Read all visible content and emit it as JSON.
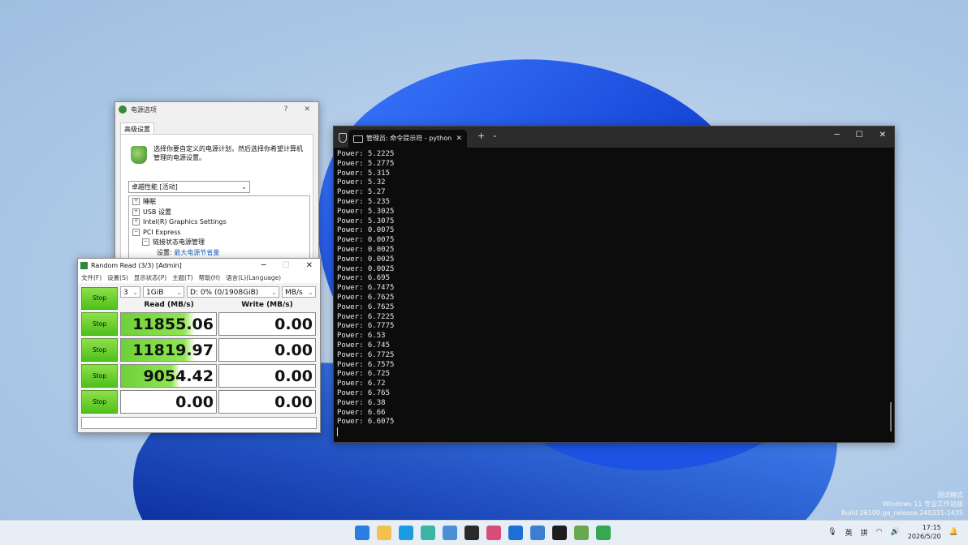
{
  "desktop": {
    "watermark": [
      "测试模式",
      "Windows 11 专业工作站版",
      "Build 26100.ge_release.240331-1435"
    ]
  },
  "power_window": {
    "title": "电源选项",
    "help": "?",
    "close": "✕",
    "tab": "高级设置",
    "description": "选择你要自定义的电源计划，然后选择你希望计算机管理的电源设置。",
    "plan": "卓越性能 [活动]",
    "tree": [
      {
        "sign": "+",
        "label": "睡眠",
        "indent": 0
      },
      {
        "sign": "+",
        "label": "USB 设置",
        "indent": 0
      },
      {
        "sign": "+",
        "label": "Intel(R) Graphics Settings",
        "indent": 0
      },
      {
        "sign": "−",
        "label": "PCI Express",
        "indent": 0
      },
      {
        "sign": "−",
        "label": "链接状态电源管理",
        "indent": 1
      }
    ],
    "setting_label": "设置:",
    "setting_value": "最大电源节省量"
  },
  "cdm_window": {
    "title": "Random Read (3/3) [Admin]",
    "menu": [
      "文件(F)",
      "设置(S)",
      "显示状态(P)",
      "主题(T)",
      "帮助(H)",
      "语言(L)(Language)"
    ],
    "stop_label": "Stop",
    "count": "3",
    "size": "1GiB",
    "drive": "D: 0% (0/1908GiB)",
    "unit": "MB/s",
    "read_header": "Read (MB/s)",
    "write_header": "Write (MB/s)",
    "rows": [
      {
        "read": "11855.06",
        "write": "0.00",
        "read_fill": 0.78
      },
      {
        "read": "11819.97",
        "write": "0.00",
        "read_fill": 0.78
      },
      {
        "read": "9054.42",
        "write": "0.00",
        "read_fill": 0.62
      },
      {
        "read": "0.00",
        "write": "0.00",
        "read_fill": 0
      }
    ]
  },
  "terminal": {
    "tab_title": "管理员: 命令提示符 - python",
    "tab_close": "✕",
    "new_tab": "+",
    "dropdown": "⌄",
    "min": "─",
    "max": "☐",
    "close": "✕",
    "lines": [
      "Power: 5.2225",
      "Power: 5.2775",
      "Power: 5.315",
      "Power: 5.32",
      "Power: 5.27",
      "Power: 5.235",
      "Power: 5.3025",
      "Power: 5.3075",
      "Power: 0.0075",
      "Power: 0.0075",
      "Power: 0.0025",
      "Power: 0.0025",
      "Power: 0.0025",
      "Power: 6.695",
      "Power: 6.7475",
      "Power: 6.7625",
      "Power: 6.7625",
      "Power: 6.7225",
      "Power: 6.7775",
      "Power: 6.53",
      "Power: 6.745",
      "Power: 6.7725",
      "Power: 6.7575",
      "Power: 6.725",
      "Power: 6.72",
      "Power: 6.765",
      "Power: 6.38",
      "Power: 6.66",
      "Power: 6.6075"
    ]
  },
  "taskbar": {
    "apps": [
      "start-icon",
      "file-explorer-icon",
      "edge-icon",
      "app-icon",
      "image-viewer-icon",
      "terminal-icon",
      "snipping-icon",
      "defender-icon",
      "window-icon",
      "cmd-icon",
      "gpu-icon",
      "diskmark-icon"
    ],
    "ime1": "英",
    "ime2": "拼",
    "time": "17:15",
    "date": "2026/5/20"
  }
}
